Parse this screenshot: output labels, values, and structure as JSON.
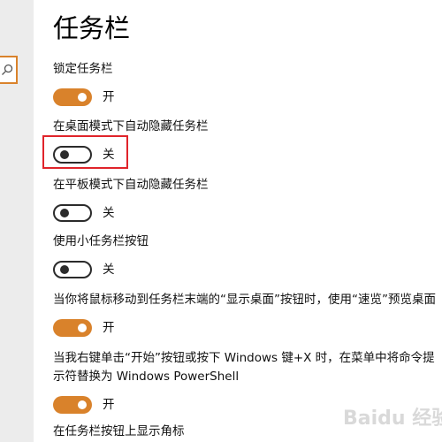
{
  "page": {
    "title": "任务栏"
  },
  "settings": [
    {
      "label": "锁定任务栏",
      "state": "开",
      "on": true
    },
    {
      "label": "在桌面模式下自动隐藏任务栏",
      "state": "关",
      "on": false
    },
    {
      "label": "在平板模式下自动隐藏任务栏",
      "state": "关",
      "on": false
    },
    {
      "label": "使用小任务栏按钮",
      "state": "关",
      "on": false
    },
    {
      "label": "当你将鼠标移动到任务栏末端的“显示桌面”按钮时，使用“速览”预览桌面",
      "state": "开",
      "on": true
    },
    {
      "label_line1": "当我右键单击“开始”按钮或按下 Windows 键+X 时，在菜单中将命令提",
      "label_line2": "示符替换为 Windows PowerShell",
      "state": "开",
      "on": true
    },
    {
      "label": "在任务栏按钮上显示角标"
    }
  ],
  "watermark": {
    "text": "Baidu 经验"
  },
  "colors": {
    "accent": "#d9822b",
    "highlight": "#e0242b",
    "toggle_off": "#2b2b2b",
    "sidebar_bg": "#ececec"
  },
  "icons": {
    "search": "search-icon"
  }
}
